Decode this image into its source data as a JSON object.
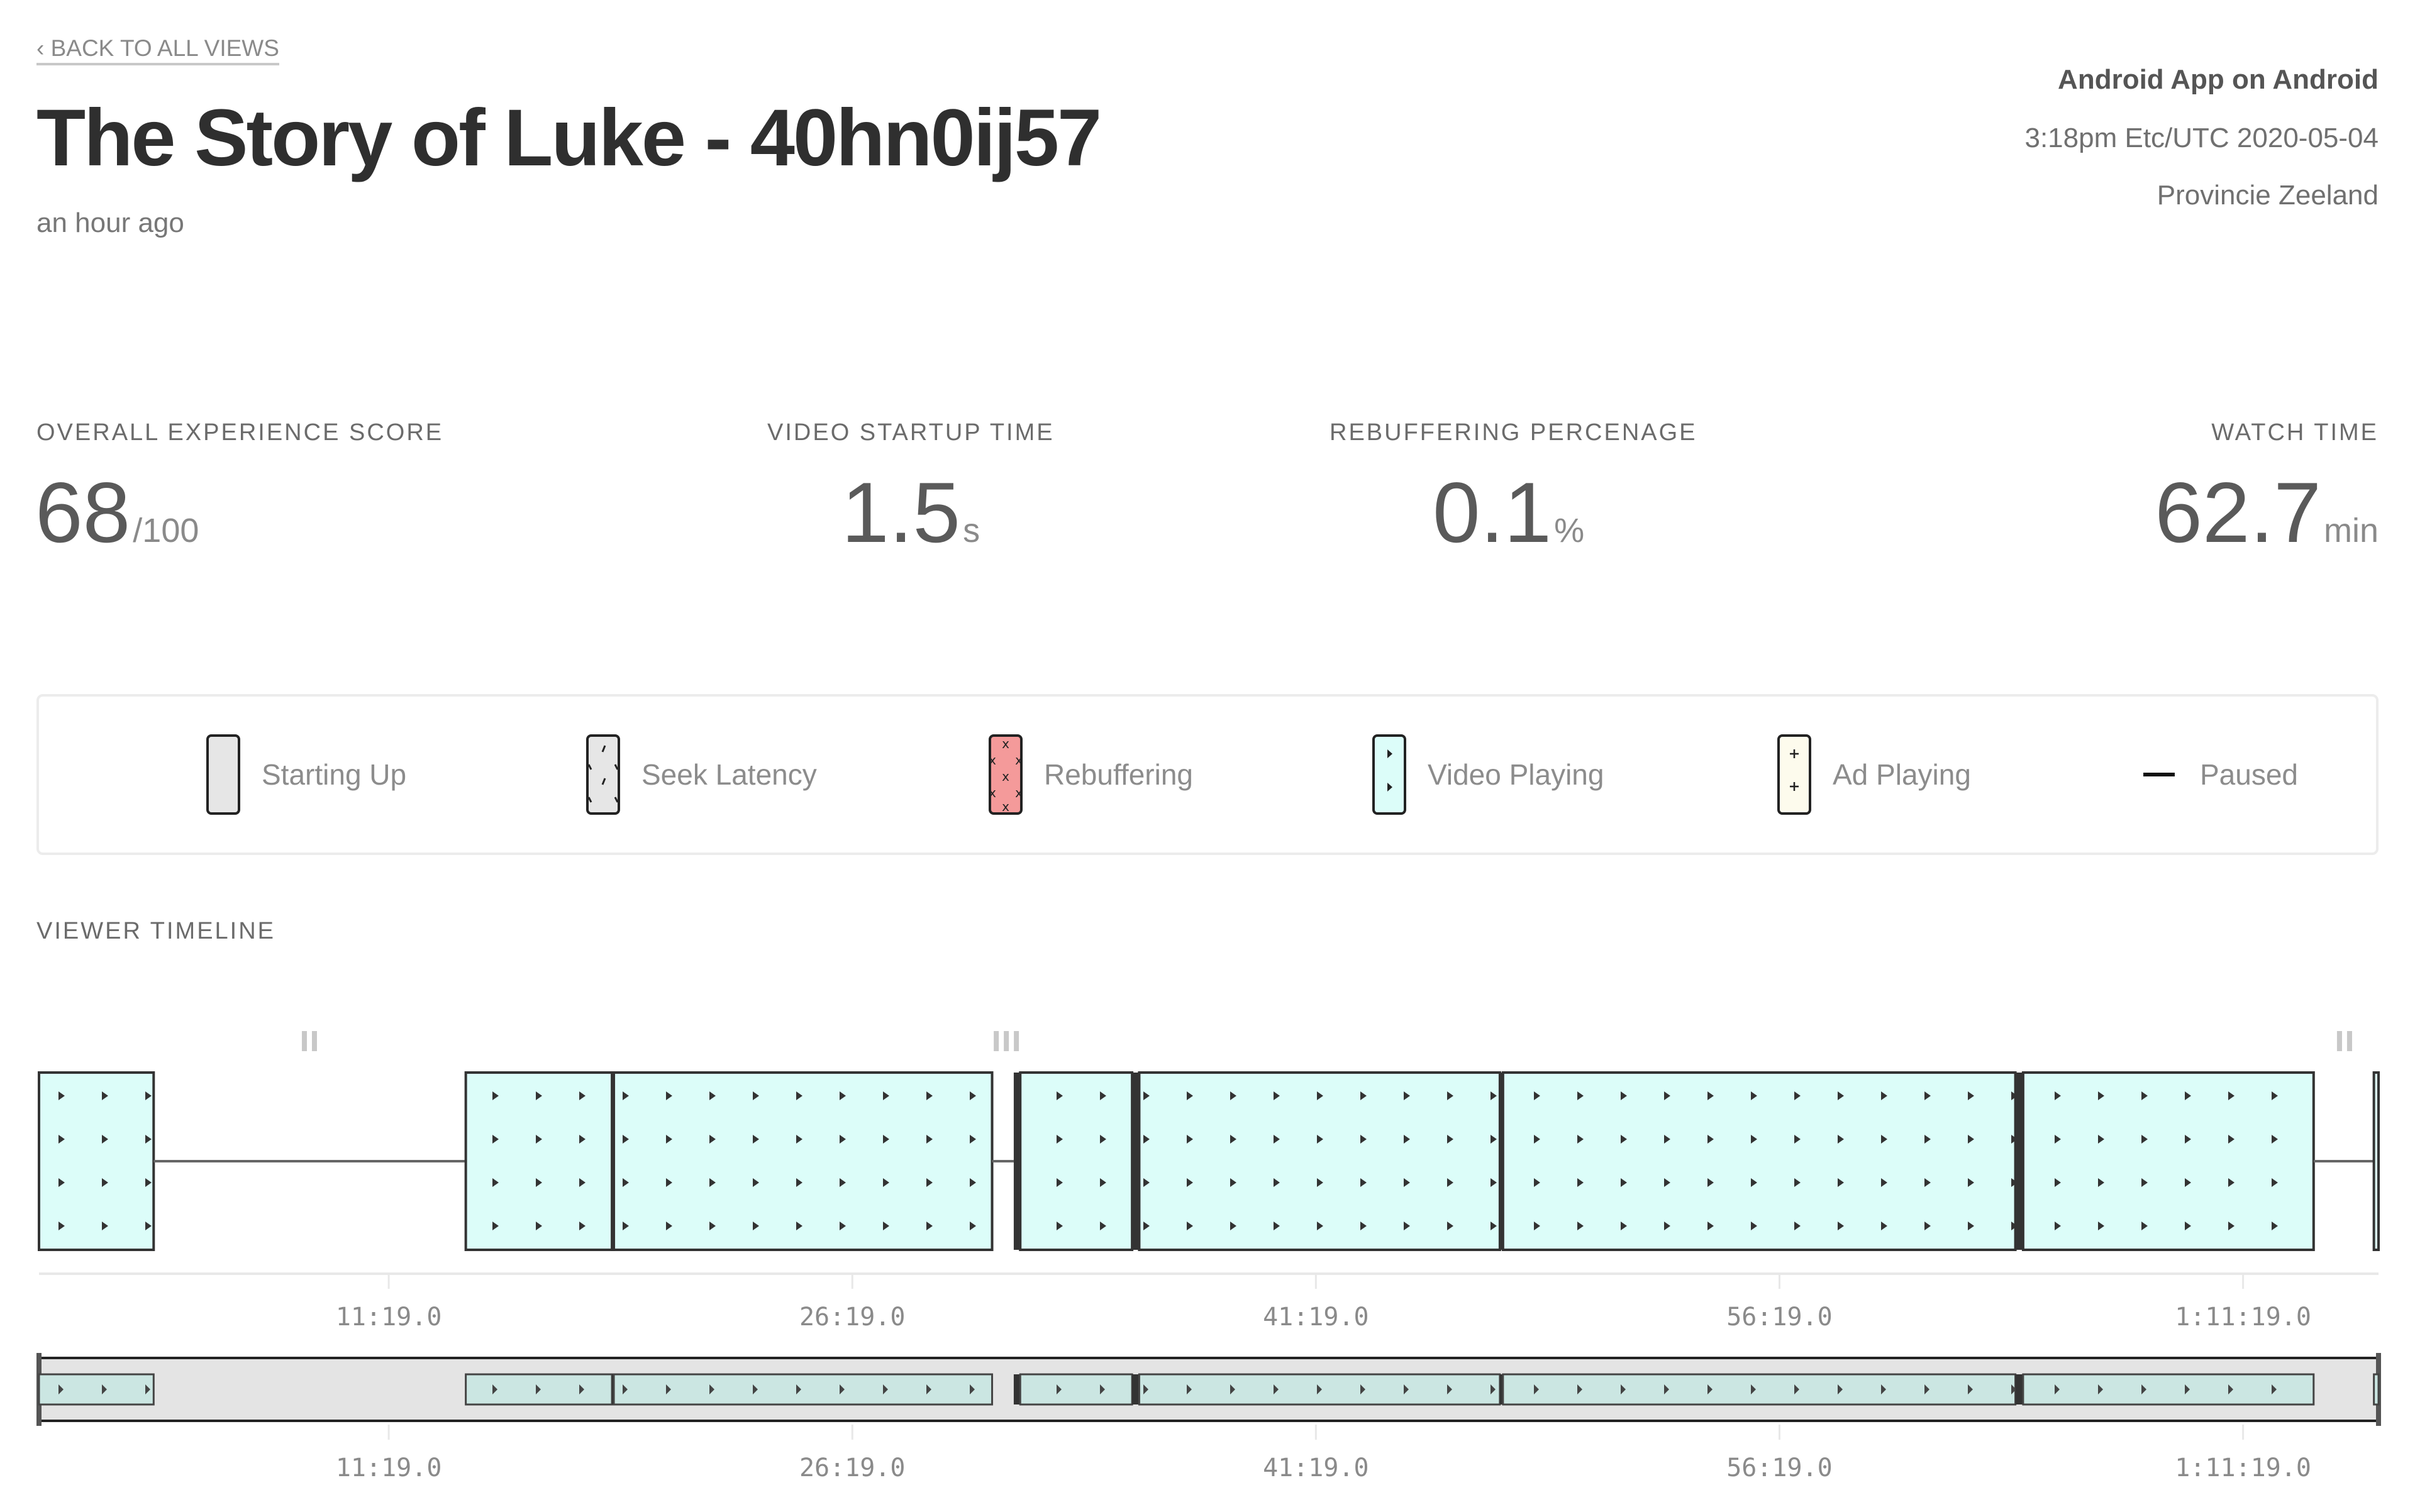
{
  "header": {
    "back_link": "‹ BACK TO ALL VIEWS",
    "title": "The Story of Luke - 40hn0ij57",
    "time_ago": "an hour ago",
    "device": "Android App on Android",
    "datetime": "3:18pm Etc/UTC 2020-05-04",
    "location": "Provincie Zeeland"
  },
  "metrics": [
    {
      "label": "OVERALL EXPERIENCE SCORE",
      "value": "68",
      "unit": "/100"
    },
    {
      "label": "VIDEO STARTUP TIME",
      "value": "1.5",
      "unit": "s"
    },
    {
      "label": "REBUFFERING PERCENAGE",
      "value": "0.1",
      "unit": "%"
    },
    {
      "label": "WATCH TIME",
      "value": "62.7",
      "unit": "min"
    }
  ],
  "legend": [
    {
      "key": "starting-up",
      "label": "Starting Up",
      "icon": "starting-up-swatch",
      "color": "#e6e6e6"
    },
    {
      "key": "seek-latency",
      "label": "Seek Latency",
      "icon": "seek-latency-swatch",
      "color": "#e6e6e6"
    },
    {
      "key": "rebuffering",
      "label": "Rebuffering",
      "icon": "rebuffering-swatch",
      "color": "#f49a9a"
    },
    {
      "key": "video-playing",
      "label": "Video Playing",
      "icon": "video-playing-swatch",
      "color": "#dcfdf9"
    },
    {
      "key": "ad-playing",
      "label": "Ad Playing",
      "icon": "ad-playing-swatch",
      "color": "#fdfbed"
    },
    {
      "key": "paused",
      "label": "Paused",
      "icon": "paused-dash",
      "color": "#111111"
    }
  ],
  "timeline": {
    "title": "VIEWER TIMELINE",
    "colors": {
      "playing": "#dcfdf9",
      "playing_overview": "#cbe6e2",
      "overview_track": "#e4e4e4",
      "border": "#333333",
      "pause_icon": "#c8c8c8",
      "axis": "#e8e8e8",
      "paused_line": "#666666"
    }
  },
  "chart_data": {
    "type": "timeline",
    "title": "VIEWER TIMELINE",
    "x_unit": "minutes",
    "xlim": [
      0,
      75.7
    ],
    "tick_values": [
      11.3167,
      26.3167,
      41.3167,
      56.3167,
      71.3167
    ],
    "tick_labels": [
      "11:19.0",
      "26:19.0",
      "41:19.0",
      "56:19.0",
      "1:11:19.0"
    ],
    "segments": [
      {
        "state": "playing",
        "start": 0.0,
        "end": 3.71
      },
      {
        "state": "paused",
        "start": 3.71,
        "end": 13.81
      },
      {
        "state": "playing",
        "start": 13.81,
        "end": 18.54
      },
      {
        "state": "seek",
        "start": 18.54,
        "end": 18.6
      },
      {
        "state": "playing",
        "start": 18.6,
        "end": 30.84
      },
      {
        "state": "paused",
        "start": 30.84,
        "end": 31.54
      },
      {
        "state": "seek",
        "start": 31.54,
        "end": 31.75
      },
      {
        "state": "playing",
        "start": 31.75,
        "end": 35.37
      },
      {
        "state": "seek",
        "start": 35.37,
        "end": 35.6
      },
      {
        "state": "playing",
        "start": 35.6,
        "end": 47.27
      },
      {
        "state": "seek",
        "start": 47.27,
        "end": 47.37
      },
      {
        "state": "playing",
        "start": 47.37,
        "end": 63.95
      },
      {
        "state": "seek",
        "start": 63.95,
        "end": 64.2
      },
      {
        "state": "playing",
        "start": 64.2,
        "end": 73.6
      },
      {
        "state": "paused",
        "start": 73.6,
        "end": 75.55
      },
      {
        "state": "playing",
        "start": 75.55,
        "end": 75.7
      }
    ],
    "pause_markers": [
      {
        "time": 8.75,
        "count": 2
      },
      {
        "time": 31.3,
        "count": 3
      },
      {
        "time": 74.6,
        "count": 2
      }
    ]
  }
}
